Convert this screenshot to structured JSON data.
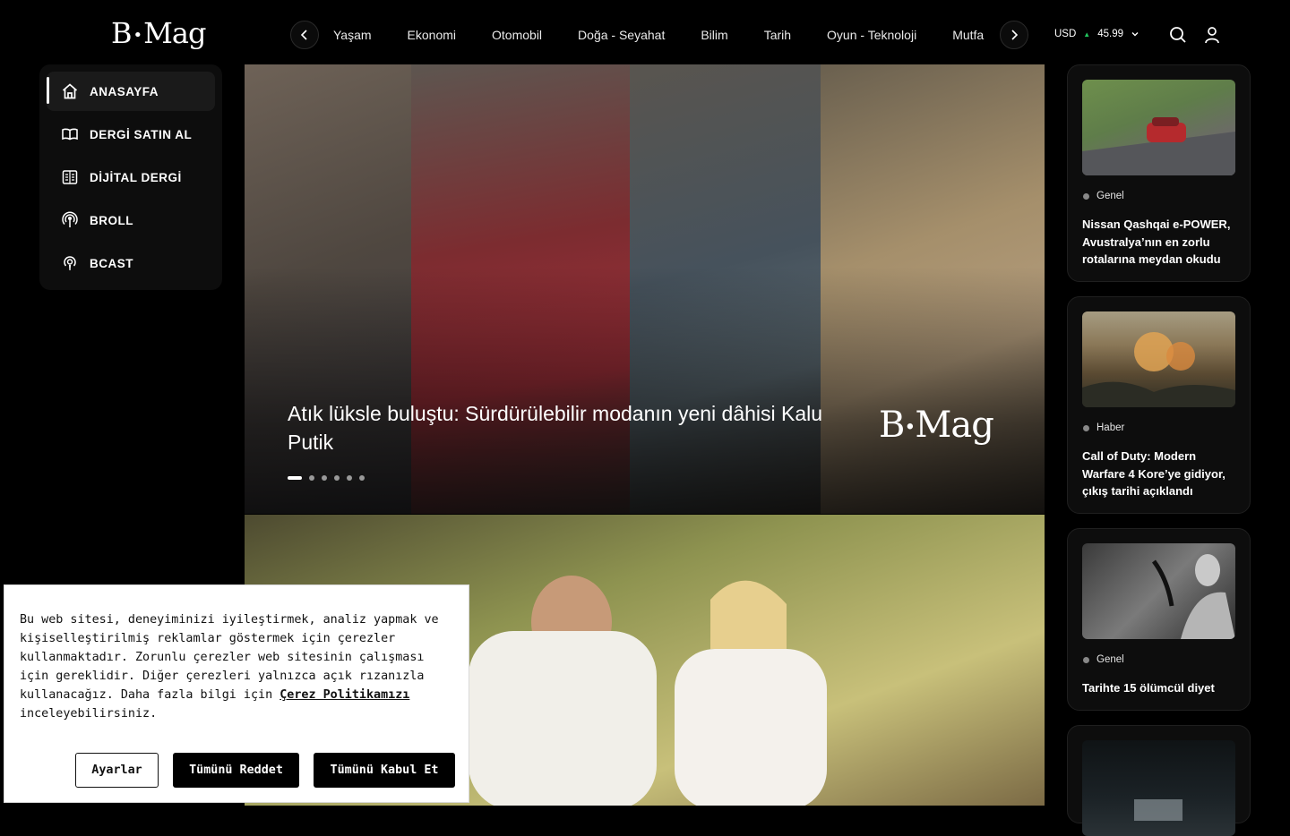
{
  "header": {
    "logo": "B·Mag",
    "nav_items": [
      "Yaşam",
      "Ekonomi",
      "Otomobil",
      "Doğa - Seyahat",
      "Bilim",
      "Tarih",
      "Oyun - Teknoloji",
      "Mutfa"
    ],
    "currency": {
      "code": "USD",
      "trend": "▲",
      "value": "45.99"
    }
  },
  "sidebar": {
    "items": [
      {
        "label": "ANASAYFA",
        "icon": "home-icon",
        "active": true
      },
      {
        "label": "DERGİ SATIN AL",
        "icon": "book-open-icon"
      },
      {
        "label": "DİJİTAL DERGİ",
        "icon": "digital-magazine-icon"
      },
      {
        "label": "BROLL",
        "icon": "broadcast-icon"
      },
      {
        "label": "BCAST",
        "icon": "podcast-icon"
      }
    ]
  },
  "hero": {
    "title": "Atık lüksle buluştu: Sürdürülebilir modanın yeni dâhisi Kalu Putik",
    "watermark": "B·Mag",
    "slide_count": 6,
    "active_slide": 1
  },
  "cards": [
    {
      "category": "Genel",
      "title": "Nissan Qashqai e-POWER, Avustralya’nın en zorlu rotalarına meydan okudu"
    },
    {
      "category": "Haber",
      "title": "Call of Duty: Modern Warfare 4 Kore’ye gidiyor, çıkış tarihi açıklandı"
    },
    {
      "category": "Genel",
      "title": "Tarihte 15 ölümcül diyet"
    }
  ],
  "cookie": {
    "text": "Bu web sitesi, deneyiminizi iyileştirmek, analiz yapmak ve kişiselleştirilmiş reklamlar göstermek için çerezler kullanmaktadır. Zorunlu çerezler web sitesinin çalışması için gereklidir. Diğer çerezleri yalnızca açık rızanızla kullanacağız. Daha fazla bilgi için ",
    "link": "Çerez Politikamızı",
    "text_end": " inceleyebilirsiniz.",
    "settings_label": "Ayarlar",
    "reject_label": "Tümünü Reddet",
    "accept_label": "Tümünü Kabul Et"
  }
}
